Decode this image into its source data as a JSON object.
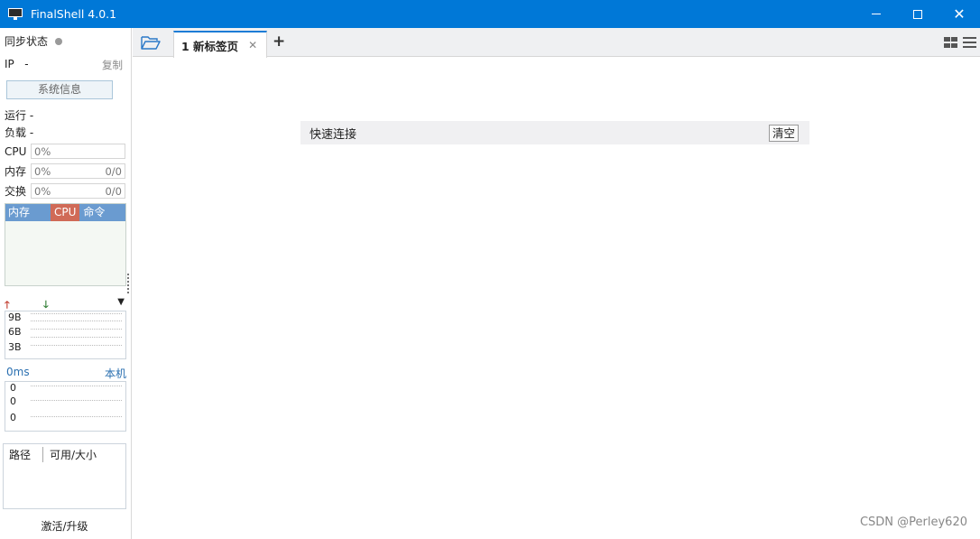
{
  "window": {
    "title": "FinalShell 4.0.1"
  },
  "sidebar": {
    "sync_label": "同步状态",
    "ip_label": "IP",
    "ip_value": "-",
    "copy_label": "复制",
    "sysinfo_label": "系统信息",
    "run_label": "运行 -",
    "load_label": "负载 -",
    "cpu_label": "CPU",
    "cpu_value": "0%",
    "mem_label": "内存",
    "mem_value": "0%",
    "mem_amount": "0/0",
    "swap_label": "交换",
    "swap_value": "0%",
    "swap_amount": "0/0",
    "proc_headers": [
      "内存",
      "CPU",
      "命令"
    ],
    "net_ticks": [
      "9B",
      "6B",
      "3B"
    ],
    "latency_value": "0ms",
    "latency_target": "本机",
    "latency_ticks": [
      "0",
      "0",
      "0"
    ],
    "disk_headers": [
      "路径",
      "可用/大小"
    ],
    "activate_label": "激活/升级"
  },
  "tabs": [
    {
      "label": "1 新标签页",
      "active": true
    }
  ],
  "main": {
    "quick_connect_label": "快速连接",
    "clear_label": "清空"
  },
  "watermark": "CSDN @Perley620",
  "colors": {
    "titlebar": "#0078d7",
    "proc_header": "#6a9bd0",
    "proc_cpu": "#d06a57",
    "tab_accent": "#1d7cd6"
  }
}
